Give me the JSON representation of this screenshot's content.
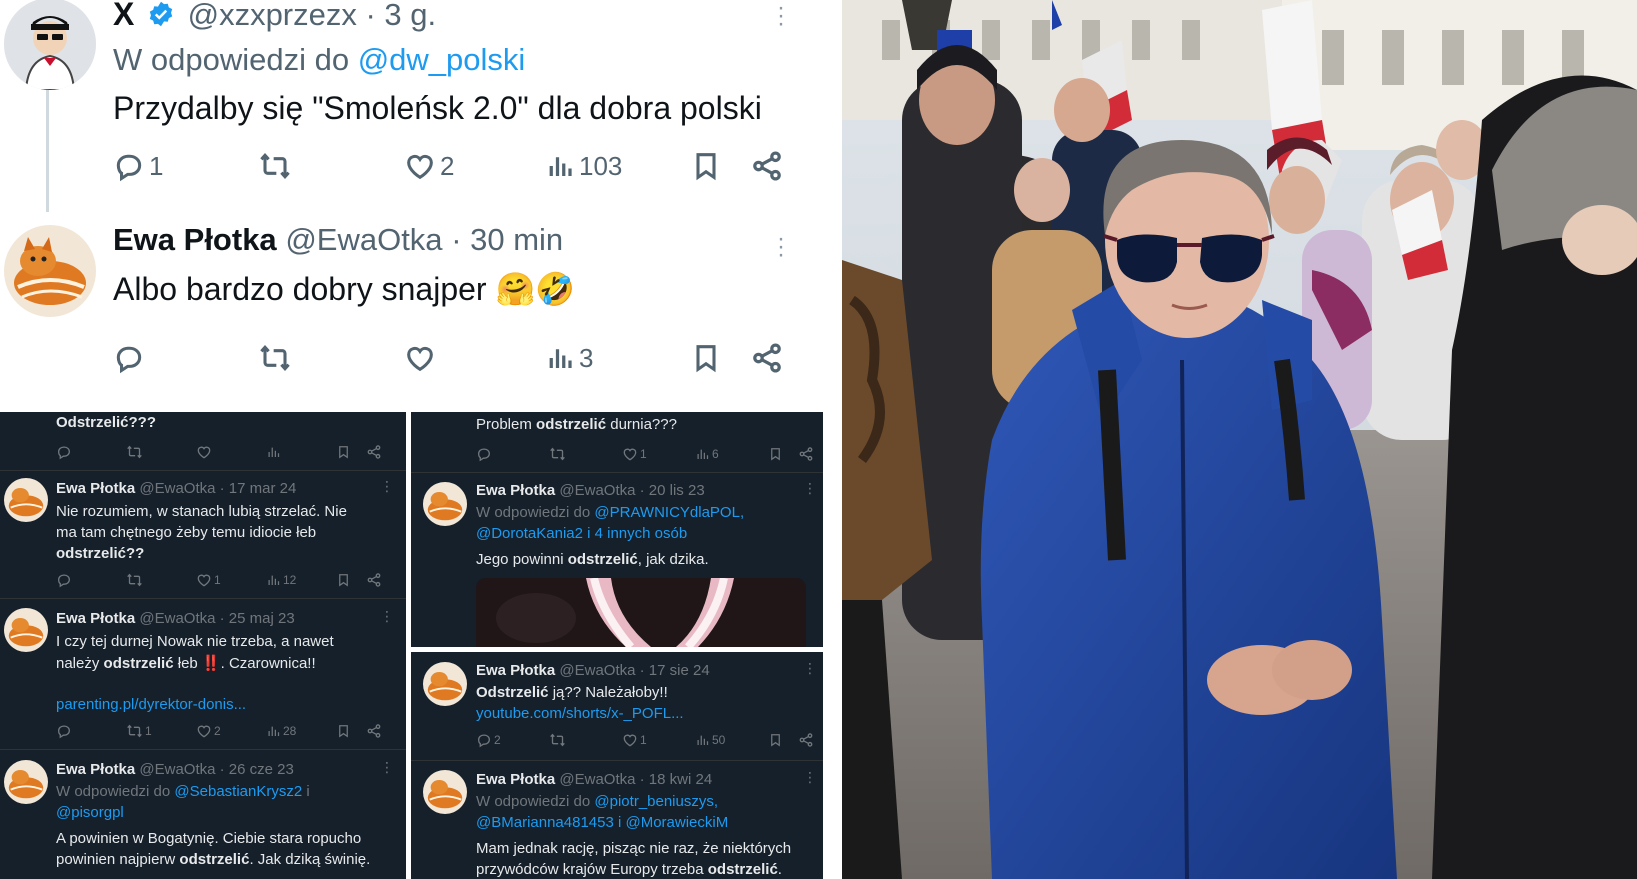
{
  "tweet1": {
    "x_mark": "X",
    "handle": "@xzxprzezx",
    "time": "· 3 g.",
    "reply_to_prefix": "W odpowiedzi do ",
    "reply_to": "@dw_polski",
    "text": "Przydalby się \"Smoleńsk 2.0\" dla dobra polski",
    "replies": "1",
    "likes": "2",
    "views": "103"
  },
  "tweet2": {
    "name": "Ewa Płotka",
    "handle": "@EwaOtka",
    "time": "· 30 min",
    "text": "Albo bardzo dobry snajper",
    "emoji": "🤗🤣",
    "views": "3"
  },
  "grid_left": {
    "top_text": "Odstrzelić???",
    "t1": {
      "name": "Ewa Płotka",
      "meta": "@EwaOtka · 17 mar 24",
      "line1": "Nie rozumiem, w stanach lubią strzelać. Nie",
      "line2": "ma tam chętnego żeby temu idiocie łeb",
      "line3": "odstrzelić??",
      "likes": "1",
      "views": "12"
    },
    "t2": {
      "name": "Ewa Płotka",
      "meta": "@EwaOtka · 25 maj 23",
      "line1": "I czy tej durnej Nowak nie trzeba, a nawet",
      "line2a": "należy ",
      "line2b": "odstrzelić",
      "line2c": " łeb ",
      "line2d": "‼️",
      "line2e": ". Czarownica!!",
      "link": "parenting.pl/dyrektor-donis...",
      "replies": "1",
      "likes": "2",
      "views": "28"
    },
    "t3": {
      "name": "Ewa Płotka",
      "meta": "@EwaOtka · 26 cze 23",
      "reply_prefix": "W odpowiedzi do ",
      "reply1": "@SebastianKrysz2",
      "reply_mid": " i",
      "reply2": "@pisorgpl",
      "line1": "A powinien w Bogatynię. Ciebie stara ropucho",
      "line2a": "powinien najpierw ",
      "line2b": "odstrzelić",
      "line2c": ". Jak dziką świnię."
    }
  },
  "grid_right": {
    "top_a": "Problem ",
    "top_b": "odstrzelić",
    "top_c": " durnia???",
    "top_likes": "1",
    "top_views": "6",
    "t1": {
      "name": "Ewa Płotka",
      "meta": "@EwaOtka · 20 lis 23",
      "reply_prefix": "W odpowiedzi do ",
      "reply1": "@PRAWNICYdlaPOL,",
      "reply2": "@DorotaKania2 i 4 innych osób",
      "line_a": "Jego powinni ",
      "line_b": "odstrzelić",
      "line_c": ", jak dzika."
    },
    "t2": {
      "name": "Ewa Płotka",
      "meta": "@EwaOtka · 17 sie 24",
      "line_a": "Odstrzelić",
      "line_b": " ją?? Należałoby!!",
      "link": "youtube.com/shorts/x-_POFL...",
      "replies": "2",
      "likes": "1",
      "views": "50"
    },
    "t3": {
      "name": "Ewa Płotka",
      "meta": "@EwaOtka · 18 kwi 24",
      "reply_prefix": "W odpowiedzi do ",
      "reply1": "@piotr_beniuszys,",
      "reply2": "@BMarianna481453 i @MorawieckiM",
      "line1": "Mam jednak rację, pisząc nie raz, że niektórych",
      "line2a": "przywódców krajów Europy trzeba ",
      "line2b": "odstrzelić",
      "line2c": "."
    }
  },
  "colors": {
    "x_blue": "#1d9bf0",
    "dark_bg": "#15202b",
    "muted": "#536471"
  }
}
